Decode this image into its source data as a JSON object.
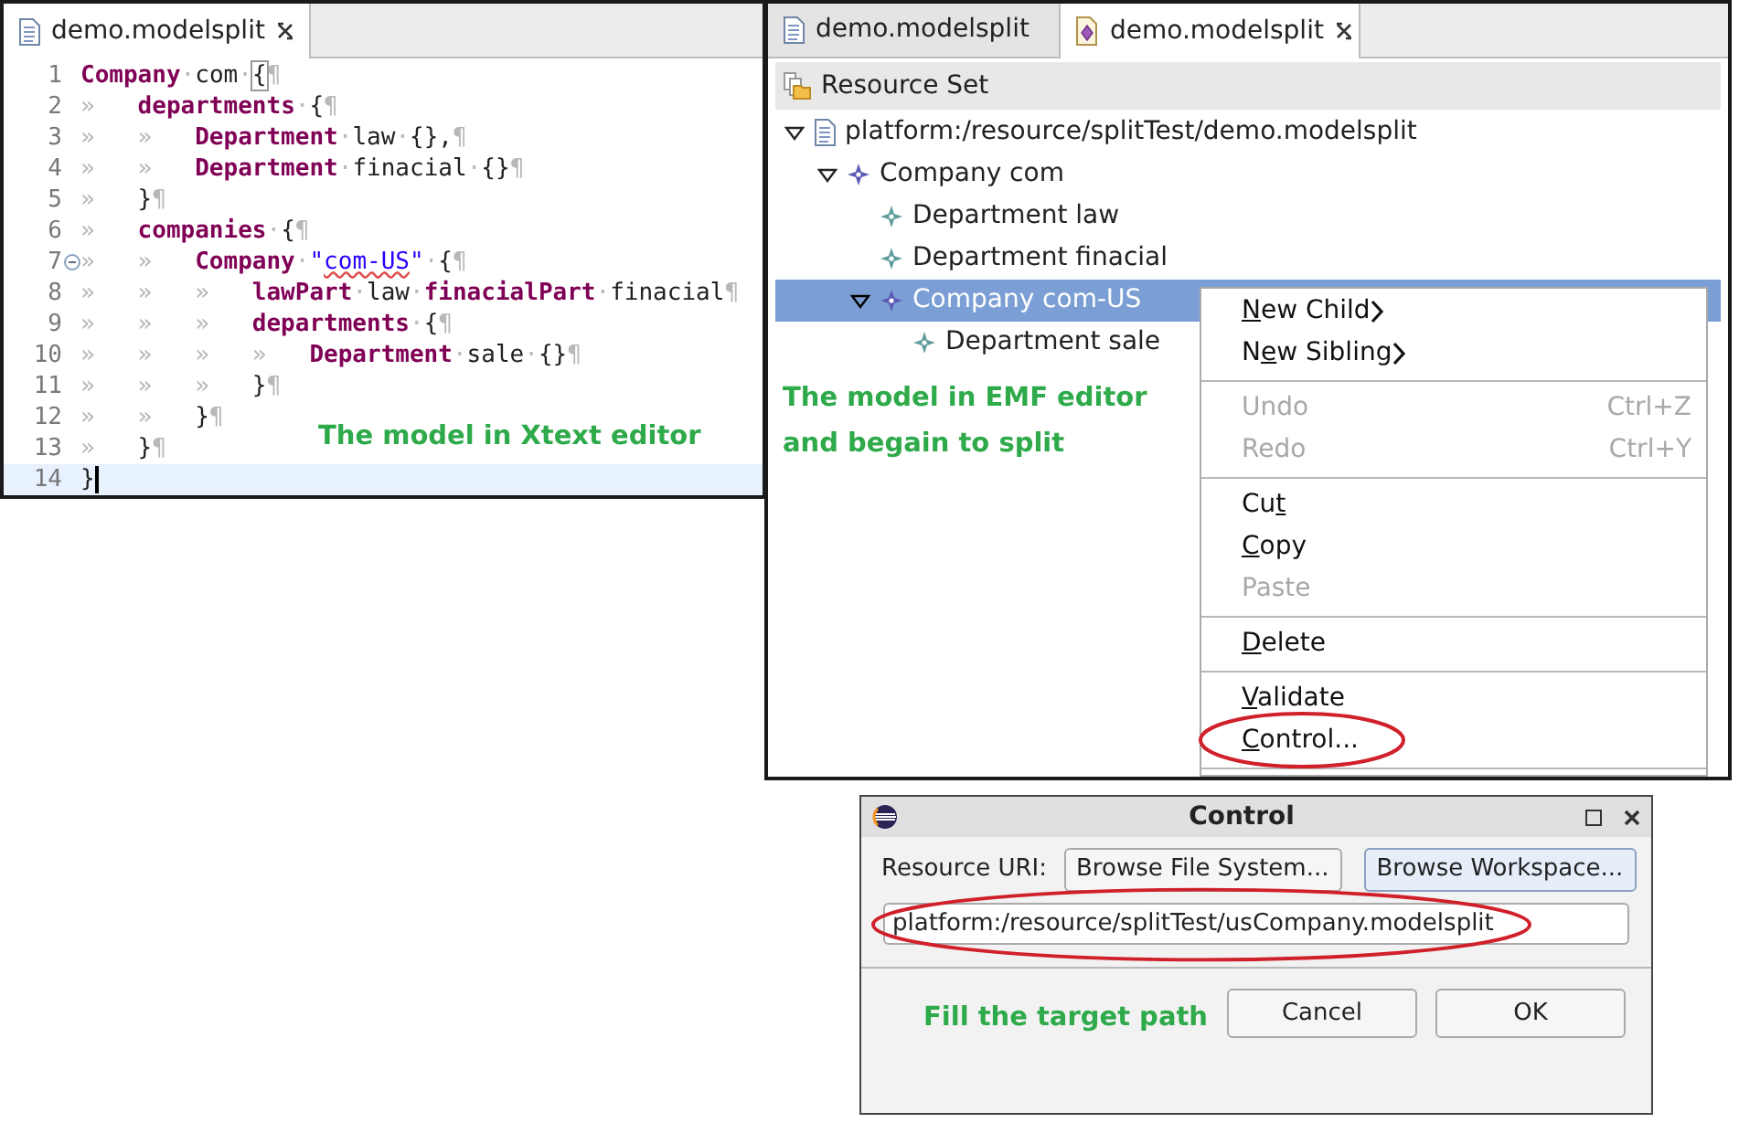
{
  "xtext_editor": {
    "tab": {
      "label": "demo.modelsplit",
      "selected": true
    },
    "lines": [
      {
        "number": "1",
        "current": false,
        "folding": false,
        "tokens": [
          {
            "kind": "kw",
            "text": "Company"
          },
          {
            "kind": "ws",
            "text": "·"
          },
          {
            "kind": "id",
            "text": "com"
          },
          {
            "kind": "ws",
            "text": "·"
          },
          {
            "kind": "match",
            "text": "{"
          },
          {
            "kind": "ws",
            "text": "¶"
          }
        ]
      },
      {
        "number": "2",
        "current": false,
        "folding": false,
        "tokens": [
          {
            "kind": "tab",
            "text": "»"
          },
          {
            "kind": "kw",
            "text": "departments"
          },
          {
            "kind": "ws",
            "text": "·"
          },
          {
            "kind": "id",
            "text": "{"
          },
          {
            "kind": "ws",
            "text": "¶"
          }
        ]
      },
      {
        "number": "3",
        "current": false,
        "folding": false,
        "tokens": [
          {
            "kind": "tab",
            "text": "»"
          },
          {
            "kind": "tab",
            "text": "»"
          },
          {
            "kind": "kw",
            "text": "Department"
          },
          {
            "kind": "ws",
            "text": "·"
          },
          {
            "kind": "id",
            "text": "law"
          },
          {
            "kind": "ws",
            "text": "·"
          },
          {
            "kind": "id",
            "text": "{},"
          },
          {
            "kind": "ws",
            "text": "¶"
          }
        ]
      },
      {
        "number": "4",
        "current": false,
        "folding": false,
        "tokens": [
          {
            "kind": "tab",
            "text": "»"
          },
          {
            "kind": "tab",
            "text": "»"
          },
          {
            "kind": "kw",
            "text": "Department"
          },
          {
            "kind": "ws",
            "text": "·"
          },
          {
            "kind": "id",
            "text": "finacial"
          },
          {
            "kind": "ws",
            "text": "·"
          },
          {
            "kind": "id",
            "text": "{}"
          },
          {
            "kind": "ws",
            "text": "¶"
          }
        ]
      },
      {
        "number": "5",
        "current": false,
        "folding": false,
        "tokens": [
          {
            "kind": "tab",
            "text": "»"
          },
          {
            "kind": "id",
            "text": "}"
          },
          {
            "kind": "ws",
            "text": "¶"
          }
        ]
      },
      {
        "number": "6",
        "current": false,
        "folding": false,
        "tokens": [
          {
            "kind": "tab",
            "text": "»"
          },
          {
            "kind": "kw",
            "text": "companies"
          },
          {
            "kind": "ws",
            "text": "·"
          },
          {
            "kind": "id",
            "text": "{"
          },
          {
            "kind": "ws",
            "text": "¶"
          }
        ]
      },
      {
        "number": "7",
        "current": false,
        "folding": true,
        "tokens": [
          {
            "kind": "tab",
            "text": "»"
          },
          {
            "kind": "tab",
            "text": "»"
          },
          {
            "kind": "kw",
            "text": "Company"
          },
          {
            "kind": "ws",
            "text": "·"
          },
          {
            "kind": "str",
            "text": "\""
          },
          {
            "kind": "misspelled",
            "text": "com-US"
          },
          {
            "kind": "str",
            "text": "\""
          },
          {
            "kind": "ws",
            "text": "·"
          },
          {
            "kind": "id",
            "text": "{"
          },
          {
            "kind": "ws",
            "text": "¶"
          }
        ]
      },
      {
        "number": "8",
        "current": false,
        "folding": false,
        "tokens": [
          {
            "kind": "tab",
            "text": "»"
          },
          {
            "kind": "tab",
            "text": "»"
          },
          {
            "kind": "tab",
            "text": "»"
          },
          {
            "kind": "kw",
            "text": "lawPart"
          },
          {
            "kind": "ws",
            "text": "·"
          },
          {
            "kind": "id",
            "text": "law"
          },
          {
            "kind": "ws",
            "text": "·"
          },
          {
            "kind": "kw",
            "text": "finacialPart"
          },
          {
            "kind": "ws",
            "text": "·"
          },
          {
            "kind": "id",
            "text": "finacial"
          },
          {
            "kind": "ws",
            "text": "¶"
          }
        ]
      },
      {
        "number": "9",
        "current": false,
        "folding": false,
        "tokens": [
          {
            "kind": "tab",
            "text": "»"
          },
          {
            "kind": "tab",
            "text": "»"
          },
          {
            "kind": "tab",
            "text": "»"
          },
          {
            "kind": "kw",
            "text": "departments"
          },
          {
            "kind": "ws",
            "text": "·"
          },
          {
            "kind": "id",
            "text": "{"
          },
          {
            "kind": "ws",
            "text": "¶"
          }
        ]
      },
      {
        "number": "10",
        "current": false,
        "folding": false,
        "tokens": [
          {
            "kind": "tab",
            "text": "»"
          },
          {
            "kind": "tab",
            "text": "»"
          },
          {
            "kind": "tab",
            "text": "»"
          },
          {
            "kind": "tab",
            "text": "»"
          },
          {
            "kind": "kw",
            "text": "Department"
          },
          {
            "kind": "ws",
            "text": "·"
          },
          {
            "kind": "id",
            "text": "sale"
          },
          {
            "kind": "ws",
            "text": "·"
          },
          {
            "kind": "id",
            "text": "{}"
          },
          {
            "kind": "ws",
            "text": "¶"
          }
        ]
      },
      {
        "number": "11",
        "current": false,
        "folding": false,
        "tokens": [
          {
            "kind": "tab",
            "text": "»"
          },
          {
            "kind": "tab",
            "text": "»"
          },
          {
            "kind": "tab",
            "text": "»"
          },
          {
            "kind": "id",
            "text": "}"
          },
          {
            "kind": "ws",
            "text": "¶"
          }
        ]
      },
      {
        "number": "12",
        "current": false,
        "folding": false,
        "tokens": [
          {
            "kind": "tab",
            "text": "»"
          },
          {
            "kind": "tab",
            "text": "»"
          },
          {
            "kind": "id",
            "text": "}"
          },
          {
            "kind": "ws",
            "text": "¶"
          }
        ]
      },
      {
        "number": "13",
        "current": false,
        "folding": false,
        "tokens": [
          {
            "kind": "tab",
            "text": "»"
          },
          {
            "kind": "id",
            "text": "}"
          },
          {
            "kind": "ws",
            "text": "¶"
          }
        ]
      },
      {
        "number": "14",
        "current": true,
        "folding": false,
        "tokens": [
          {
            "kind": "id",
            "text": "}"
          }
        ]
      }
    ],
    "annotation": "The model in Xtext editor"
  },
  "emf_editor": {
    "tabs": [
      {
        "label": "demo.modelsplit",
        "kind": "text",
        "selected": false
      },
      {
        "label": "demo.modelsplit",
        "kind": "model",
        "selected": true
      }
    ],
    "toolbar_label": "Resource Set",
    "tree": [
      {
        "label": "platform:/resource/splitTest/demo.modelsplit",
        "kind": "file",
        "expanded": true,
        "selected": false,
        "children": [
          {
            "label": "Company com",
            "kind": "company",
            "expanded": true,
            "selected": false,
            "children": [
              {
                "label": "Department law",
                "kind": "department",
                "selected": false
              },
              {
                "label": "Department finacial",
                "kind": "department",
                "selected": false
              },
              {
                "label": "Company com-US",
                "kind": "company",
                "expanded": true,
                "selected": true,
                "children": [
                  {
                    "label": "Department sale",
                    "kind": "department",
                    "selected": false
                  }
                ]
              }
            ]
          }
        ]
      }
    ],
    "annotation": "The model in EMF editor and begain to split",
    "context_menu": [
      {
        "items": [
          {
            "label": {
              "key": "N",
              "post": "ew Child"
            },
            "disabled": false,
            "submenu": true,
            "circled": false
          },
          {
            "label": {
              "pre": "N",
              "key": "e",
              "post": "w Sibling"
            },
            "disabled": false,
            "submenu": true,
            "circled": false
          }
        ]
      },
      {
        "items": [
          {
            "label": {
              "pre": "Undo"
            },
            "shortcut": "Ctrl+Z",
            "disabled": true,
            "submenu": false,
            "circled": false
          },
          {
            "label": {
              "pre": "Redo"
            },
            "shortcut": "Ctrl+Y",
            "disabled": true,
            "submenu": false,
            "circled": false
          }
        ]
      },
      {
        "items": [
          {
            "label": {
              "pre": "Cu",
              "key": "t"
            },
            "disabled": false,
            "submenu": false,
            "circled": false
          },
          {
            "label": {
              "key": "C",
              "post": "opy"
            },
            "disabled": false,
            "submenu": false,
            "circled": false
          },
          {
            "label": {
              "pre": "Paste"
            },
            "disabled": true,
            "submenu": false,
            "circled": false
          }
        ]
      },
      {
        "items": [
          {
            "label": {
              "key": "D",
              "post": "elete"
            },
            "disabled": false,
            "submenu": false,
            "circled": false
          }
        ]
      },
      {
        "items": [
          {
            "label": {
              "key": "V",
              "post": "alidate"
            },
            "disabled": false,
            "submenu": false,
            "circled": false
          },
          {
            "label": {
              "key": "C",
              "post": "ontrol..."
            },
            "disabled": false,
            "submenu": false,
            "circled": true
          }
        ]
      }
    ]
  },
  "dialog": {
    "title": "Control",
    "uri_label": "Resource URI:",
    "browse_buttons": [
      {
        "label": "Browse File System...",
        "focused": false
      },
      {
        "label": "Browse Workspace...",
        "focused": true
      }
    ],
    "uri_field": {
      "value": "platform:/resource/splitTest/usCompany.modelsplit",
      "circled": true
    },
    "annotation": "Fill the target path",
    "buttons": [
      "Cancel",
      "OK"
    ]
  }
}
